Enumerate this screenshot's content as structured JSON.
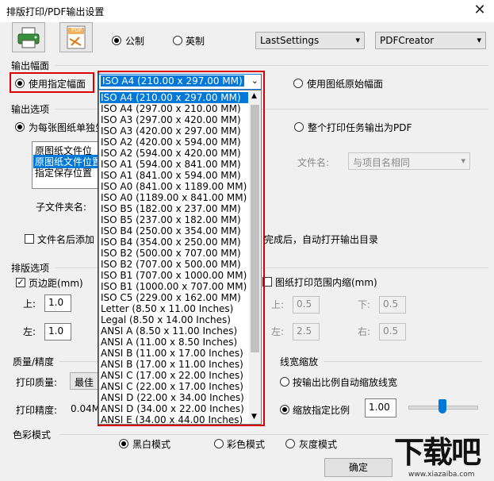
{
  "window": {
    "title": "排版打印/PDF输出设置",
    "close": "✕"
  },
  "toolbar": {
    "units": {
      "metric": "公制",
      "imperial": "英制",
      "selected": "metric"
    },
    "settings_combo": "LastSettings",
    "printer_combo": "PDFCreator",
    "pdf_icon_text": "PDF"
  },
  "output_size": {
    "group_label": "输出幅面",
    "use_specified": "使用指定幅面",
    "use_original": "使用图纸原始幅面",
    "selected_size": "ISO A4 (210.00 x 297.00 MM)",
    "options": [
      "ISO A4 (210.00 x 297.00 MM)",
      "ISO A4 (297.00 x 210.00 MM)",
      "ISO A3 (297.00 x 420.00 MM)",
      "ISO A3 (420.00 x 297.00 MM)",
      "ISO A2 (420.00 x 594.00 MM)",
      "ISO A2 (594.00 x 420.00 MM)",
      "ISO A1 (594.00 x 841.00 MM)",
      "ISO A1 (841.00 x 594.00 MM)",
      "ISO A0 (841.00 x 1189.00 MM)",
      "ISO A0 (1189.00 x 841.00 MM)",
      "ISO B5 (182.00 x 237.00 MM)",
      "ISO B5 (237.00 x 182.00 MM)",
      "ISO B4 (250.00 x 354.00 MM)",
      "ISO B4 (354.00 x 250.00 MM)",
      "ISO B2 (500.00 x 707.00 MM)",
      "ISO B2 (707.00 x 500.00 MM)",
      "ISO B1 (707.00 x 1000.00 MM)",
      "ISO B1 (1000.00 x 707.00 MM)",
      "ISO C5 (229.00 x 162.00 MM)",
      "Letter (8.50 x 11.00 Inches)",
      "Legal (8.50 x 14.00 Inches)",
      "ANSI A (8.50 x 11.00 Inches)",
      "ANSI A (11.00 x 8.50 Inches)",
      "ANSI B (11.00 x 17.00 Inches)",
      "ANSI B (17.00 x 11.00 Inches)",
      "ANSI C (17.00 x 22.00 Inches)",
      "ANSI C (22.00 x 17.00 Inches)",
      "ANSI D (22.00 x 34.00 Inches)",
      "ANSI D (34.00 x 22.00 Inches)",
      "ANSI E (34.00 x 44.00 Inches)"
    ]
  },
  "output_options": {
    "group_label": "输出选项",
    "per_sheet": "为每张图纸单独生",
    "whole_job": "整个打印任务输出为PDF",
    "location_list": [
      "原图纸文件位置",
      "原图纸文件位置",
      "指定保存位置"
    ],
    "filename_label": "文件名:",
    "filename_value": "与项目名相同",
    "subfolder_label": "子文件夹名:",
    "append_label": "文件名后添加",
    "open_after": "完成后，自动打开输出目录"
  },
  "layout": {
    "group_label": "排版选项",
    "margin_check": "页边距(mm)",
    "top_label": "上:",
    "top_value": "1.0",
    "left_label": "左:",
    "left_value": "1.0",
    "shrink_check": "图纸打印范围内缩(mm)",
    "s_top_label": "上:",
    "s_top_value": "0.5",
    "s_bottom_label": "下:",
    "s_bottom_value": "0.5",
    "s_left_label": "左:",
    "s_left_value": "2.5",
    "s_right_label": "右:",
    "s_right_value": "0.5"
  },
  "quality": {
    "group_label": "质量/精度",
    "print_quality_label": "打印质量:",
    "print_quality_value": "最佳",
    "precision_label": "打印精度:",
    "precision_value": "0.04M"
  },
  "linewidth": {
    "group_label": "线宽缩放",
    "auto": "按输出比例自动缩放线宽",
    "specified": "缩放指定比例",
    "value": "1.00",
    "slider_fraction": 0.5
  },
  "color": {
    "group_label": "色彩模式",
    "bw": "黑白模式",
    "color": "彩色模式",
    "gray": "灰度模式"
  },
  "footer": {
    "ok": "确定"
  },
  "watermark": {
    "logo": "下载吧",
    "url": "www.xiazaiba.com"
  }
}
